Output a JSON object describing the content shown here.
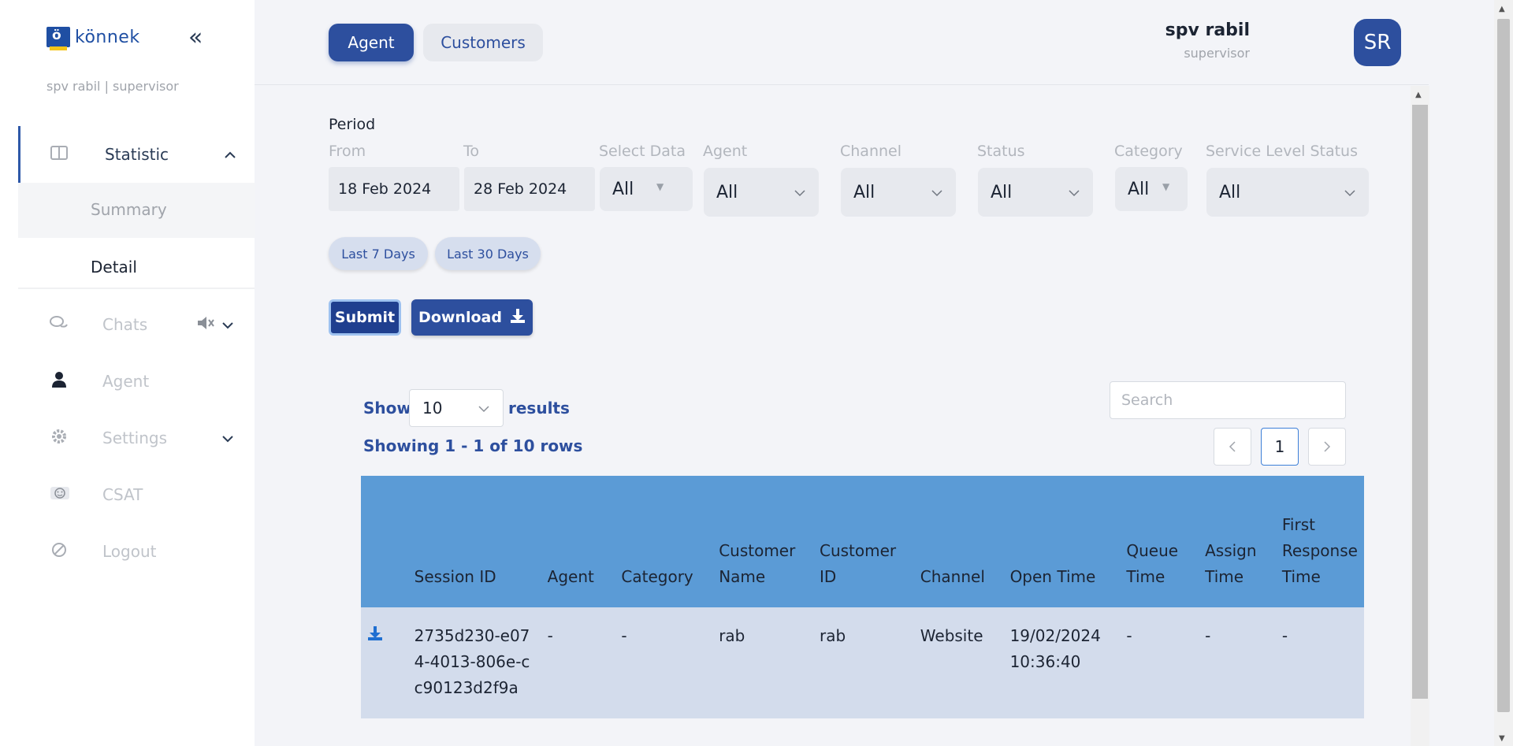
{
  "sidebar": {
    "logo_letter": "ö",
    "logo_text": "könnek",
    "user_line": "spv rabil | supervisor",
    "items": [
      {
        "label": "Statistic",
        "icon": "columns-icon"
      },
      {
        "label": "Chats",
        "icon": "chat-bubbles-icon"
      },
      {
        "label": "Agent",
        "icon": "user-icon"
      },
      {
        "label": "Settings",
        "icon": "gear-icon"
      },
      {
        "label": "CSAT",
        "icon": "smiley-icon"
      },
      {
        "label": "Logout",
        "icon": "logout-icon"
      }
    ],
    "sub_items": [
      {
        "label": "Summary"
      },
      {
        "label": "Detail"
      }
    ]
  },
  "header": {
    "tabs": [
      {
        "label": "Agent",
        "active": true
      },
      {
        "label": "Customers",
        "active": false
      }
    ],
    "user_name": "spv rabil",
    "user_role": "supervisor",
    "avatar_initials": "SR"
  },
  "filters": {
    "period_label": "Period",
    "from": {
      "label": "From",
      "value": "18 Feb 2024"
    },
    "to": {
      "label": "To",
      "value": "28 Feb 2024"
    },
    "select_data": {
      "label": "Select Data",
      "value": "All"
    },
    "agent": {
      "label": "Agent",
      "value": "All"
    },
    "channel": {
      "label": "Channel",
      "value": "All"
    },
    "status": {
      "label": "Status",
      "value": "All"
    },
    "category": {
      "label": "Category",
      "value": "All"
    },
    "service_level_status": {
      "label": "Service Level Status",
      "value": "All"
    },
    "quick_ranges": [
      {
        "label": "Last 7 Days"
      },
      {
        "label": "Last 30 Days"
      }
    ],
    "submit_label": "Submit",
    "download_label": "Download"
  },
  "table_controls": {
    "show_label": "Show",
    "page_size": "10",
    "results_label": "results",
    "showing_text": "Showing 1 - 1 of 10 rows",
    "search_placeholder": "Search",
    "current_page": "1"
  },
  "table": {
    "columns": [
      "",
      "Session ID",
      "Agent",
      "Category",
      "Customer Name",
      "Customer ID",
      "Channel",
      "Open Time",
      "Queue Time",
      "Assign Time",
      "First Response Time"
    ],
    "rows": [
      {
        "session_id": "2735d230-e074-4013-806e-cc90123d2f9a",
        "agent": "-",
        "category": "-",
        "customer_name": "rab",
        "customer_id": "rab",
        "channel": "Website",
        "open_time": "19/02/2024 10:36:40",
        "queue_time": "-",
        "assign_time": "-",
        "first_response_time": "-"
      }
    ]
  },
  "colors": {
    "primary": "#2d4f9e",
    "table_header": "#5b9bd6",
    "table_row": "#d3dcec"
  }
}
